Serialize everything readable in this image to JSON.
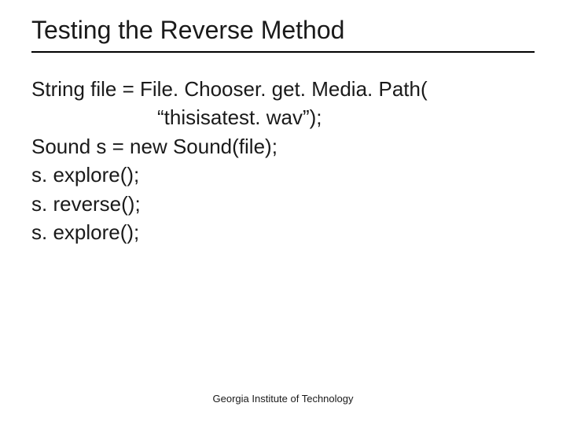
{
  "slide": {
    "title": "Testing the Reverse Method",
    "code": {
      "line1": "String file = File. Chooser. get. Media. Path(",
      "line2": "“thisisatest. wav”);",
      "line3": "Sound s = new Sound(file);",
      "line4": "s. explore();",
      "line5": "s. reverse();",
      "line6": "s. explore();"
    },
    "footer": "Georgia Institute of Technology"
  }
}
